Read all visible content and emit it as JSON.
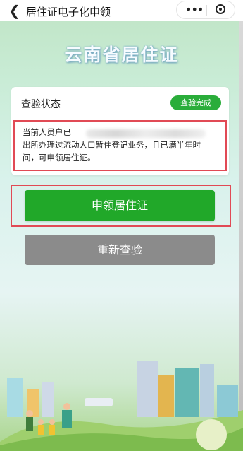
{
  "navbar": {
    "back_icon": "chevron-left-icon",
    "title": "居住证电子化申领",
    "more_icon": "more-dots-icon",
    "close_icon": "target-icon"
  },
  "banner": {
    "title": "云南省居住证"
  },
  "status_card": {
    "title": "查验状态",
    "badge": "查验完成",
    "notice_line1": "当前人员户已",
    "notice_line2": "出所办理过流动人口暂住登记业务，且已满半年时",
    "notice_line3": "间，可申领居住证。"
  },
  "actions": {
    "apply_label": "申领居住证",
    "recheck_label": "重新查验"
  },
  "colors": {
    "accent": "#21a829",
    "badge": "#2aad3a",
    "highlight": "#e14a55",
    "secondary_button": "#8b8b8b"
  }
}
